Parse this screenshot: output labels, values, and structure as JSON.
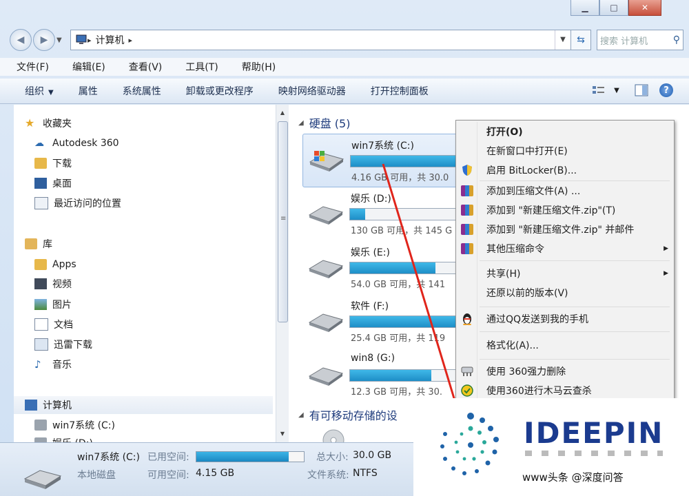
{
  "window": {
    "address": [
      "计算机"
    ],
    "search_placeholder": "搜索 计算机"
  },
  "menubar": [
    "文件(F)",
    "编辑(E)",
    "查看(V)",
    "工具(T)",
    "帮助(H)"
  ],
  "commandbar": [
    "组织",
    "属性",
    "系统属性",
    "卸载或更改程序",
    "映射网络驱动器",
    "打开控制面板"
  ],
  "navpane": {
    "favorites": {
      "label": "收藏夹",
      "items": [
        "Autodesk 360",
        "下载",
        "桌面",
        "最近访问的位置"
      ]
    },
    "libraries": {
      "label": "库",
      "items": [
        "Apps",
        "视频",
        "图片",
        "文档",
        "迅雷下载",
        "音乐"
      ]
    },
    "computer": {
      "label": "计算机",
      "items": [
        "win7系统 (C:)",
        "娱乐 (D:)"
      ]
    }
  },
  "content": {
    "hdd_group": "硬盘 (5)",
    "removable_group": "有可移动存储的设",
    "drives": [
      {
        "name": "win7系统 (C:)",
        "free": "4.16 GB 可用，共 30.0",
        "used_fraction": 0.86
      },
      {
        "name": "娱乐 (D:)",
        "free": "130 GB 可用，共 145 G",
        "used_fraction": 0.11
      },
      {
        "name": "娱乐 (E:)",
        "free": "54.0 GB 可用，共 141",
        "used_fraction": 0.62
      },
      {
        "name": "软件 (F:)",
        "free": "25.4 GB 可用，共 119",
        "used_fraction": 0.79
      },
      {
        "name": "win8 (G:)",
        "free": "12.3 GB 可用，共 30.",
        "used_fraction": 0.59
      }
    ]
  },
  "context_menu": {
    "items": [
      "打开(O)",
      "在新窗口中打开(E)",
      "启用 BitLocker(B)...",
      "添加到压缩文件(A) ...",
      "添加到 \"新建压缩文件.zip\"(T)",
      "添加到 \"新建压缩文件.zip\" 并邮件",
      "其他压缩命令",
      "共享(H)",
      "还原以前的版本(V)",
      "通过QQ发送到我的手机",
      "格式化(A)...",
      "使用 360强力删除",
      "使用360进行木马云查杀"
    ]
  },
  "details": {
    "name": "win7系统 (C:)",
    "type": "本地磁盘",
    "used_label": "已用空间:",
    "free_label": "可用空间:",
    "free_value": "4.15 GB",
    "total_label": "总大小:",
    "total_value": "30.0 GB",
    "fs_label": "文件系统:",
    "fs_value": "NTFS",
    "used_fraction": 0.86
  },
  "watermark": {
    "brand": "IDEEPIN",
    "caption": "www头条 @深度问答"
  }
}
